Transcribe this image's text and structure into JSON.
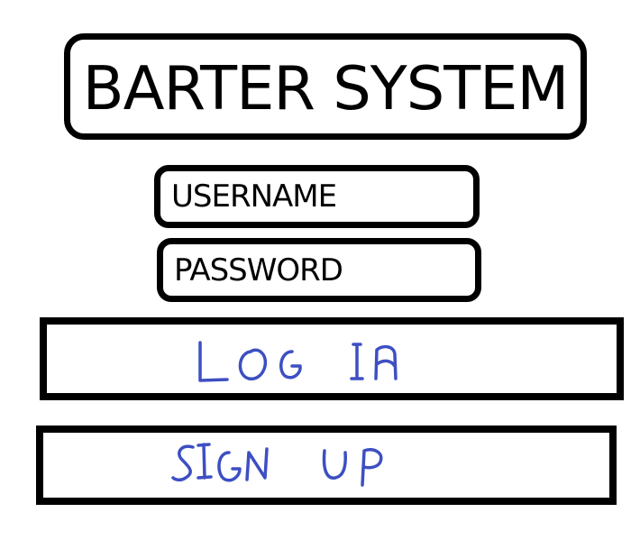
{
  "app": {
    "title": "BARTER SYSTEM"
  },
  "form": {
    "username_placeholder": "USERNAME",
    "password_placeholder": "PASSWORD"
  },
  "actions": {
    "login_label": "LOG IN",
    "signup_label": "SIGN UP"
  },
  "colors": {
    "outline": "#000000",
    "button_text": "#3d4fc2"
  }
}
